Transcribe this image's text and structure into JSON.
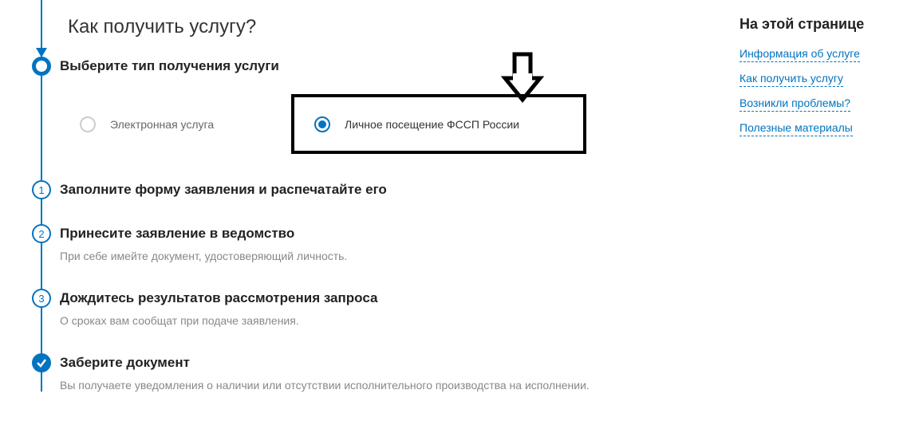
{
  "header": {
    "title": "Как получить услугу?"
  },
  "steps": {
    "s0": {
      "title": "Выберите тип получения услуги",
      "options": {
        "electronic": "Электронная услуга",
        "personal": "Личное посещение ФССП России"
      }
    },
    "s1": {
      "number": "1",
      "title": "Заполните форму заявления и распечатайте его"
    },
    "s2": {
      "number": "2",
      "title": "Принесите заявление в ведомство",
      "desc": "При себе имейте документ, удостоверяющий личность."
    },
    "s3": {
      "number": "3",
      "title": "Дождитесь результатов рассмотрения запроса",
      "desc": "О сроках вам сообщат при подаче заявления."
    },
    "s4": {
      "title": "Заберите документ",
      "desc": "Вы получаете уведомления о наличии или отсутствии исполнительного производства на исполнении."
    }
  },
  "sidebar": {
    "title": "На этой странице",
    "links": {
      "l0": "Информация об услуге",
      "l1": "Как получить услугу",
      "l2": "Возникли проблемы?",
      "l3": "Полезные материалы"
    }
  }
}
